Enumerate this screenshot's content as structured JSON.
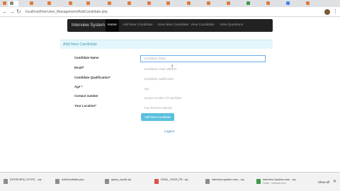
{
  "browser": {
    "url": "localhost/Interview_Management/AddCandidate.php"
  },
  "navbar": {
    "brand": "Interview System",
    "items": [
      {
        "label": "Home",
        "active": true
      },
      {
        "label": "Add New Candidate",
        "active": false
      },
      {
        "label": "View New Candidate",
        "active": false
      },
      {
        "label": "View Candidate",
        "active": false
      },
      {
        "label": "View Questions",
        "active": false
      }
    ]
  },
  "form": {
    "title": "Add New Candidate",
    "fields": [
      {
        "label": "Candidate Name",
        "placeholder": "Candidate Name"
      },
      {
        "label": "Email*",
        "placeholder": "Candidate email address"
      },
      {
        "label": "Candidate Qualification*",
        "placeholder": "Candidate qualification"
      },
      {
        "label": "Age *",
        "placeholder": "Age"
      },
      {
        "label": "Contact number",
        "placeholder": "contact number of Candidate"
      },
      {
        "label": "Your Location*",
        "placeholder": "Your Present address"
      }
    ],
    "submit_label": "Add New Candidate",
    "logout_label": "Logout"
  },
  "downloads": {
    "items": [
      {
        "name": "INTERVIEW_SYSTE....zip",
        "meta": "",
        "icon": "file"
      },
      {
        "name": "AddCandidate.php",
        "meta": "",
        "icon": "file"
      },
      {
        "name": "jquery_xkcdb.zip",
        "meta": "",
        "icon": "file"
      },
      {
        "name": "FINAL_YEAR_PR...zip",
        "meta": "",
        "icon": "red"
      },
      {
        "name": "interview-system-mas....zip",
        "meta": "",
        "icon": "file"
      },
      {
        "name": "Interview-System-mas....zip",
        "meta": "Failed - Network error",
        "icon": "green"
      }
    ],
    "show_all_label": "Show all"
  }
}
